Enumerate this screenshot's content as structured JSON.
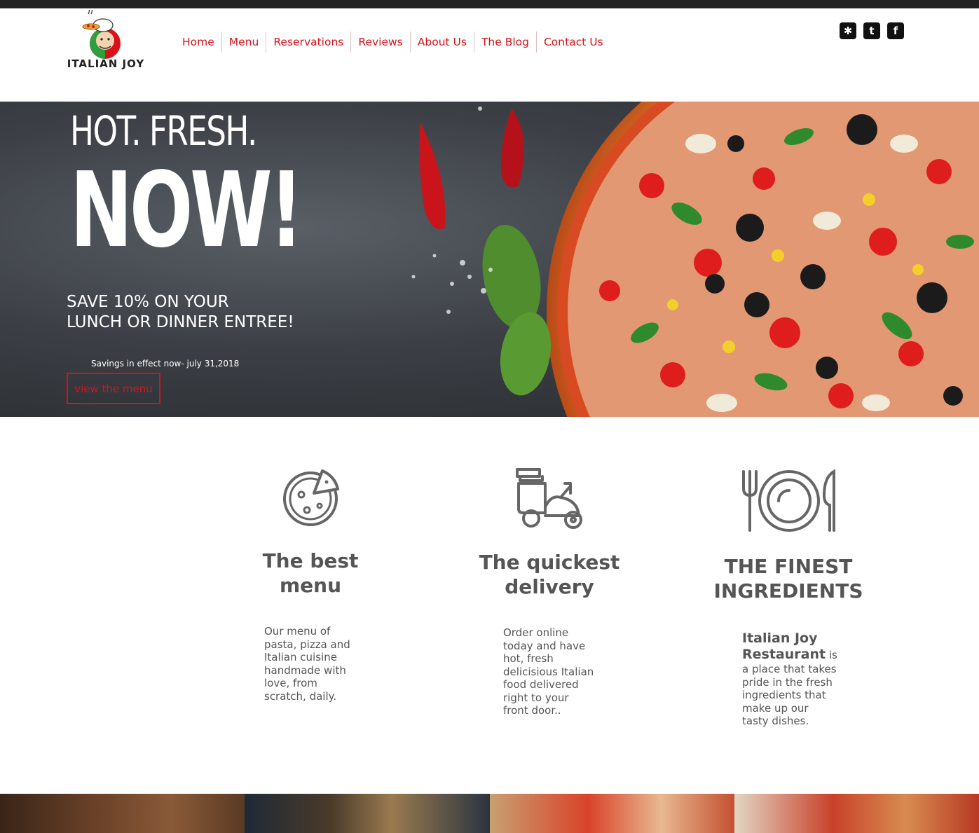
{
  "brand": {
    "name": "ITALIAN JOY",
    "accent": "#d8121b"
  },
  "nav": {
    "items": [
      {
        "label": "Home"
      },
      {
        "label": "Menu"
      },
      {
        "label": "Reservations"
      },
      {
        "label": "Reviews"
      },
      {
        "label": "About Us"
      },
      {
        "label": "The Blog"
      },
      {
        "label": "Contact Us"
      }
    ]
  },
  "social": [
    {
      "icon": "yelp-icon",
      "glyph": "✱"
    },
    {
      "icon": "twitter-icon",
      "glyph": "t"
    },
    {
      "icon": "facebook-icon",
      "glyph": "f"
    }
  ],
  "hero": {
    "line1": "HOT. FRESH.",
    "line2": "NOW!",
    "offer_line1": "SAVE 10% ON YOUR",
    "offer_line2": "LUNCH OR DINNER ENTREE!",
    "note": "Savings in effect now- july 31,2018",
    "button": "view the menu"
  },
  "features": [
    {
      "icon": "pizza-icon",
      "title_line1": "The best",
      "title_line2": "menu",
      "desc": [
        "Our menu of",
        "pasta, pizza and",
        "Italian cuisine",
        "handmade with",
        "love, from",
        "scratch, daily."
      ]
    },
    {
      "icon": "delivery-scooter-icon",
      "title_line1": "The quickest",
      "title_line2": "delivery",
      "desc": [
        "Order online",
        "today and have",
        "hot, fresh",
        "delicisious Italian",
        "food delivered",
        "right to your",
        "front door.."
      ]
    },
    {
      "icon": "plate-cutlery-icon",
      "title_line1": "THE FINEST",
      "title_line2": "INGREDIENTS",
      "desc_bold_1": "Italian Joy",
      "desc_bold_2": "Restaurant",
      "desc_rest_1": " is",
      "desc": [
        "a place that takes",
        "pride in the fresh",
        "ingredients that",
        "make up our",
        "tasty dishes."
      ]
    }
  ]
}
